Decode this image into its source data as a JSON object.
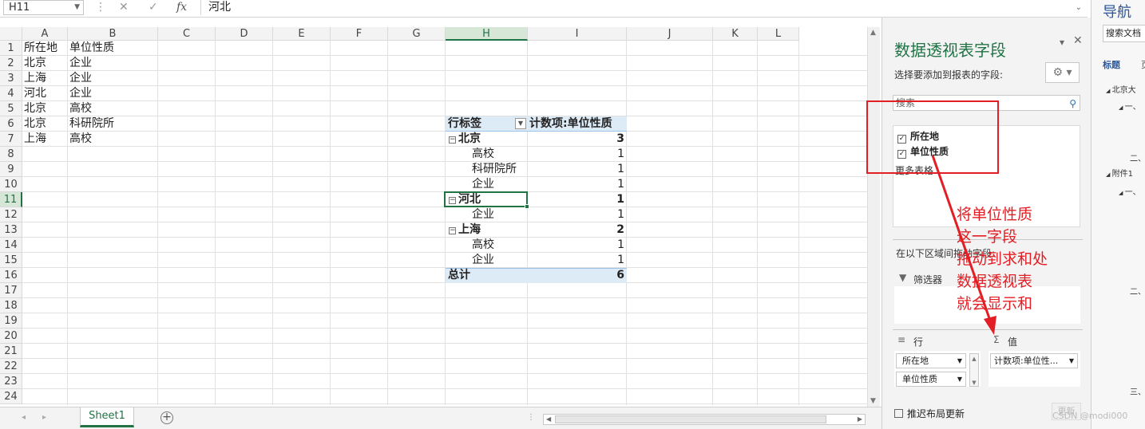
{
  "formula_bar": {
    "name_box": "H11",
    "formula": "河北",
    "cancel_glyph": "✕",
    "enter_glyph": "✓",
    "fx_glyph": "fx"
  },
  "columns": [
    "A",
    "B",
    "C",
    "D",
    "E",
    "F",
    "G",
    "H",
    "I",
    "J",
    "K",
    "L"
  ],
  "rows": [
    "1",
    "2",
    "3",
    "4",
    "5",
    "6",
    "7",
    "8",
    "9",
    "10",
    "11",
    "12",
    "13",
    "14",
    "15",
    "16",
    "17",
    "18",
    "19",
    "20",
    "21",
    "22",
    "23",
    "24"
  ],
  "active_cell": {
    "column": "H",
    "row": "11"
  },
  "cells": {
    "A1": "所在地",
    "B1": "单位性质",
    "A2": "北京",
    "B2": "企业",
    "A3": "上海",
    "B3": "企业",
    "A4": "河北",
    "B4": "企业",
    "A5": "北京",
    "B5": "高校",
    "A6": "北京",
    "B6": "科研院所",
    "A7": "上海",
    "B7": "高校"
  },
  "pivot": {
    "header_label": "行标签",
    "header_value": "计数项:单位性质",
    "collapse_glyph": "−",
    "rows": [
      {
        "label": "北京",
        "value": "3",
        "level": 0
      },
      {
        "label": "高校",
        "value": "1",
        "level": 1
      },
      {
        "label": "科研院所",
        "value": "1",
        "level": 1
      },
      {
        "label": "企业",
        "value": "1",
        "level": 1
      },
      {
        "label": "河北",
        "value": "1",
        "level": 0
      },
      {
        "label": "企业",
        "value": "1",
        "level": 1
      },
      {
        "label": "上海",
        "value": "2",
        "level": 0
      },
      {
        "label": "高校",
        "value": "1",
        "level": 1
      },
      {
        "label": "企业",
        "value": "1",
        "level": 1
      }
    ],
    "total_label": "总计",
    "total_value": "6"
  },
  "sheet_tab": "Sheet1",
  "field_pane": {
    "title": "数据透视表字段",
    "subtitle": "选择要添加到报表的字段:",
    "search_placeholder": "搜索",
    "fields": [
      {
        "label": "所在地",
        "checked": true
      },
      {
        "label": "单位性质",
        "checked": true
      }
    ],
    "more_tables": "更多表格...",
    "drag_hint": "在以下区域间拖动字段:",
    "filters_label": "筛选器",
    "rows_label": "行",
    "values_label": "值",
    "row_fields": [
      "所在地",
      "单位性质"
    ],
    "value_fields": [
      "计数项:单位性..."
    ],
    "defer_label": "推迟布局更新",
    "update_button": "更新"
  },
  "nav_pane": {
    "title": "导航",
    "search_placeholder": "搜索文档",
    "tabs": [
      "标题",
      "页"
    ],
    "items": [
      "北京大",
      "一、",
      "二、",
      "附件1",
      "一、",
      "二、",
      "三、"
    ]
  },
  "annotation": {
    "lines": [
      "将单位性质",
      "这一字段",
      "拖动到求和处",
      "数据透视表",
      "就会显示和"
    ]
  },
  "watermark": "CSDN @modi000",
  "colors": {
    "excel_green": "#217346",
    "pivot_band": "#ddebf7",
    "annotation_red": "#e31e24",
    "word_blue": "#2b579a"
  }
}
